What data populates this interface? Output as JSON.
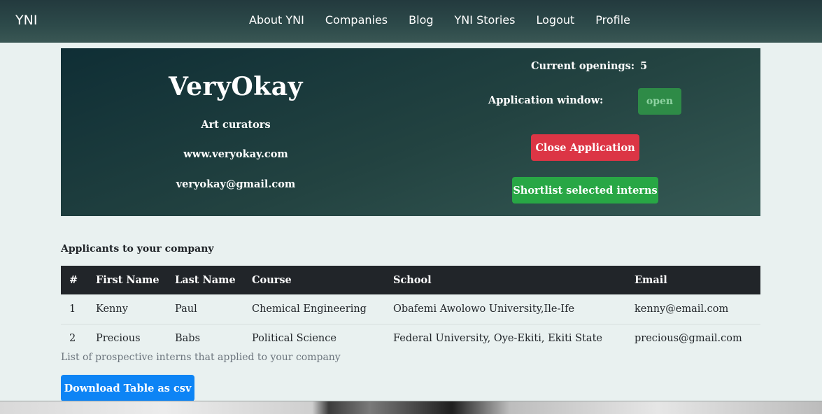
{
  "navbar": {
    "brand": "YNI",
    "links": [
      "About YNI",
      "Companies",
      "Blog",
      "YNI Stories",
      "Logout",
      "Profile"
    ]
  },
  "company": {
    "name": "VeryOkay",
    "tagline": "Art curators",
    "website": "www.veryokay.com",
    "email": "veryokay@gmail.com"
  },
  "openings": {
    "label": "Current openings:",
    "count": "5"
  },
  "application_window": {
    "label": "Application window:",
    "status": "open"
  },
  "actions": {
    "close_label": "Close Application",
    "shortlist_label": "Shortlist selected interns",
    "download_label": "Download Table as csv"
  },
  "applicants": {
    "title": "Applicants to your company",
    "caption": "List of prospective interns that applied to your company",
    "columns": [
      "#",
      "First Name",
      "Last Name",
      "Course",
      "School",
      "Email"
    ],
    "rows": [
      [
        "1",
        "Kenny",
        "Paul",
        "Chemical Engineering",
        "Obafemi Awolowo University,Ile-Ife",
        "kenny@email.com"
      ],
      [
        "2",
        "Precious",
        "Babs",
        "Political Science",
        "Federal University, Oye-Ekiti, Ekiti State",
        "precious@gmail.com"
      ]
    ]
  },
  "colors": {
    "navbar": "#2d4a4a",
    "danger": "#dc3545",
    "success": "#28a745",
    "primary": "#0d84f5",
    "table_header": "#212529"
  }
}
